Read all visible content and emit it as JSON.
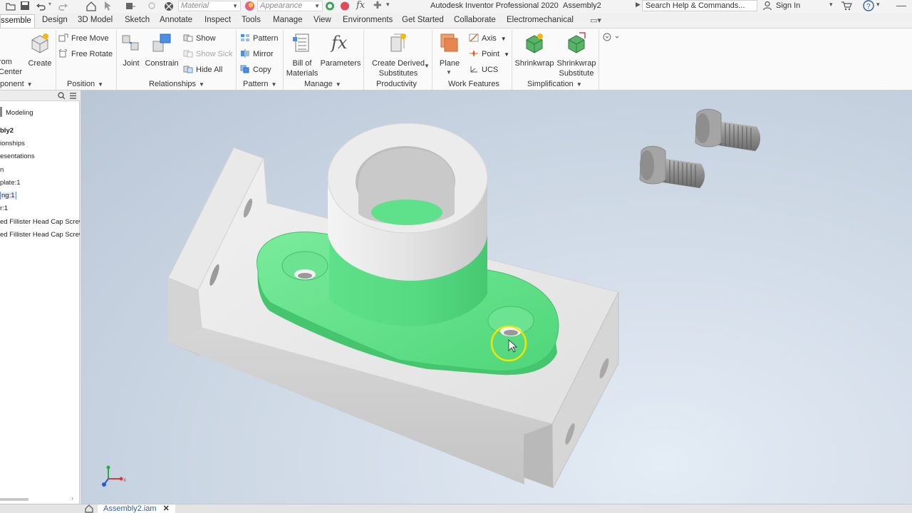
{
  "quick_access": {
    "material_placeholder": "Material",
    "appearance_placeholder": "Appearance",
    "fx_label": "fx"
  },
  "title_bar": {
    "app_title": "Autodesk Inventor Professional 2020",
    "document": "Assembly2",
    "search": "Search Help & Commands...",
    "sign_in": "Sign In"
  },
  "tabs": [
    "ssemble",
    "Design",
    "3D Model",
    "Sketch",
    "Annotate",
    "Inspect",
    "Tools",
    "Manage",
    "View",
    "Environments",
    "Get Started",
    "Collaborate",
    "Electromechanical"
  ],
  "ribbon": {
    "place_label_1": "rom",
    "place_label_2": "Center",
    "create": "Create",
    "free_move": "Free Move",
    "free_rotate": "Free Rotate",
    "joint": "Joint",
    "constrain": "Constrain",
    "show": "Show",
    "show_sick": "Show Sick",
    "hide_all": "Hide All",
    "pattern": "Pattern",
    "mirror": "Mirror",
    "copy": "Copy",
    "bom_1": "Bill of",
    "bom_2": "Materials",
    "parameters": "Parameters",
    "derived_1": "Create Derived",
    "derived_2": "Substitutes",
    "plane": "Plane",
    "axis": "Axis",
    "point": "Point",
    "ucs": "UCS",
    "shrinkwrap": "Shrinkwrap",
    "shrink_sub_1": "Shrinkwrap",
    "shrink_sub_2": "Substitute",
    "groups": {
      "component": "ponent",
      "position": "Position",
      "relationships": "Relationships",
      "pattern": "Pattern",
      "manage": "Manage",
      "productivity": "Productivity",
      "work_features": "Work Features",
      "simplification": "Simplification"
    }
  },
  "browser": {
    "tab": "Modeling",
    "items": [
      "bly2",
      "ionships",
      "esentations",
      "n",
      " plate:1",
      "ng:1",
      "r:1",
      "ed Fillister Head Cap Screw",
      "ed Fillister Head Cap Screw"
    ]
  },
  "doc_tab": "Assembly2.iam",
  "colors": {
    "highlight_green": "#5fe08a",
    "part_gray": "#e2e2e2",
    "viewport_bg": "#c9d5e3",
    "cursor_ring": "#f2e600"
  }
}
